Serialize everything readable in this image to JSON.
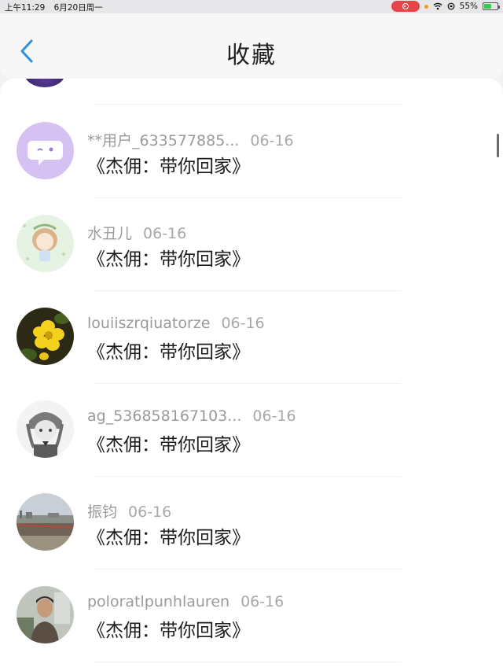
{
  "status_bar": {
    "time": "上午11:29",
    "date": "6月20日周一",
    "battery": "55%",
    "battery_level": 0.55
  },
  "header": {
    "title": "收藏",
    "back_icon": "chevron-left-icon"
  },
  "colors": {
    "accent": "#2f8fe0",
    "record_pill": "#e8454a",
    "battery_fill": "#3bc74f"
  },
  "items": [
    {
      "user": "**用户_633577885...",
      "date": "06-16",
      "title": "《杰佣：带你回家》",
      "avatar": "chat-bubble-avatar"
    },
    {
      "user": "水丑儿",
      "date": "06-16",
      "title": "《杰佣：带你回家》",
      "avatar": "anime-girl-avatar"
    },
    {
      "user": "louiiszrqiuatorze",
      "date": "06-16",
      "title": "《杰佣：带你回家》",
      "avatar": "yellow-flower-avatar"
    },
    {
      "user": "ag_536858167103...",
      "date": "06-16",
      "title": "《杰佣：带你回家》",
      "avatar": "sketch-girl-avatar"
    },
    {
      "user": "振钧",
      "date": "06-16",
      "title": "《杰佣：带你回家》",
      "avatar": "harbor-photo-avatar"
    },
    {
      "user": "poloratlpunhlauren",
      "date": "06-16",
      "title": "《杰佣：带你回家》",
      "avatar": "man-photo-avatar"
    }
  ]
}
